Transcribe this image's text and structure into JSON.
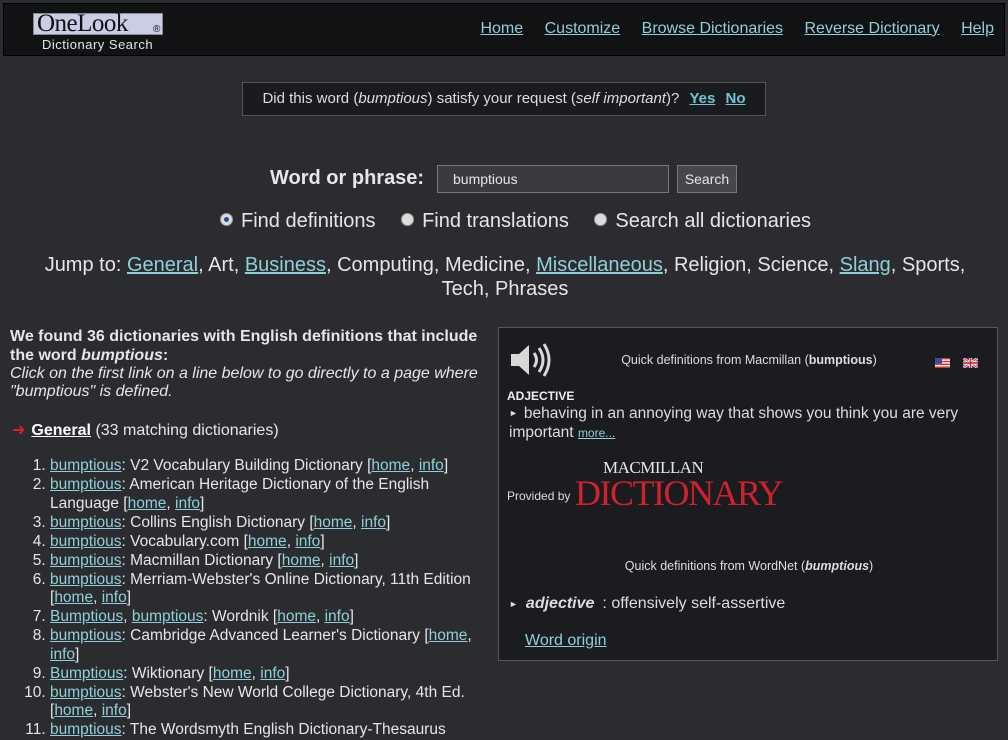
{
  "header": {
    "logo_text": "OneLook",
    "logo_reg": "®",
    "logo_sub": "Dictionary Search",
    "nav": [
      "Home",
      "Customize",
      "Browse Dictionaries",
      "Reverse Dictionary",
      "Help"
    ]
  },
  "feedback": {
    "prefix": "Did this word (",
    "word": "bumptious",
    "middle": ") satisfy your request (",
    "request": "self important",
    "suffix": ")?",
    "yes": "Yes",
    "no": "No"
  },
  "search": {
    "label": "Word or phrase:",
    "value": "bumptious",
    "button": "Search",
    "options": [
      "Find definitions",
      "Find translations",
      "Search all dictionaries"
    ],
    "selected": 0
  },
  "jump": {
    "label": "Jump to:",
    "items": [
      {
        "text": "General",
        "link": true
      },
      {
        "text": "Art",
        "link": false
      },
      {
        "text": "Business",
        "link": true
      },
      {
        "text": "Computing",
        "link": false
      },
      {
        "text": "Medicine",
        "link": false
      },
      {
        "text": "Miscellaneous",
        "link": true
      },
      {
        "text": "Religion",
        "link": false
      },
      {
        "text": "Science",
        "link": false
      },
      {
        "text": "Slang",
        "link": true
      },
      {
        "text": "Sports",
        "link": false
      },
      {
        "text": "Tech",
        "link": false
      },
      {
        "text": "Phrases",
        "link": false
      }
    ]
  },
  "results": {
    "found_prefix": "We found 36 dictionaries with English definitions that include the word ",
    "found_word": "bumptious",
    "found_suffix": ":",
    "hint": "Click on the first link on a line below to go directly to a page where \"bumptious\" is defined.",
    "category": "General",
    "category_count": "(33 matching dictionaries)",
    "home_label": "home",
    "info_label": "info",
    "dictionaries": [
      {
        "words": [
          "bumptious"
        ],
        "name": "V2 Vocabulary Building Dictionary"
      },
      {
        "words": [
          "bumptious"
        ],
        "name": "American Heritage Dictionary of the English Language"
      },
      {
        "words": [
          "bumptious"
        ],
        "name": "Collins English Dictionary"
      },
      {
        "words": [
          "bumptious"
        ],
        "name": "Vocabulary.com"
      },
      {
        "words": [
          "bumptious"
        ],
        "name": "Macmillan Dictionary"
      },
      {
        "words": [
          "bumptious"
        ],
        "name": "Merriam-Webster's Online Dictionary, 11th Edition"
      },
      {
        "words": [
          "Bumptious",
          "bumptious"
        ],
        "name": "Wordnik"
      },
      {
        "words": [
          "bumptious"
        ],
        "name": "Cambridge Advanced Learner's Dictionary"
      },
      {
        "words": [
          "Bumptious"
        ],
        "name": "Wiktionary"
      },
      {
        "words": [
          "bumptious"
        ],
        "name": "Webster's New World College Dictionary, 4th Ed."
      },
      {
        "words": [
          "bumptious"
        ],
        "name": "The Wordsmyth English Dictionary-Thesaurus"
      }
    ]
  },
  "quick": {
    "macmillan_prefix": "Quick definitions from Macmillan (",
    "word": "bumptious",
    "close": ")",
    "pos1": "ADJECTIVE",
    "def1": "behaving in an annoying way that shows you think you are very important",
    "more": "more...",
    "provided_by": "Provided by",
    "mac_top": "MACMILLAN",
    "mac_bottom": "DICTIONARY",
    "wordnet_prefix": "Quick definitions from WordNet (",
    "pos2": "adjective",
    "def2": "offensively self-assertive",
    "origin": "Word origin"
  }
}
